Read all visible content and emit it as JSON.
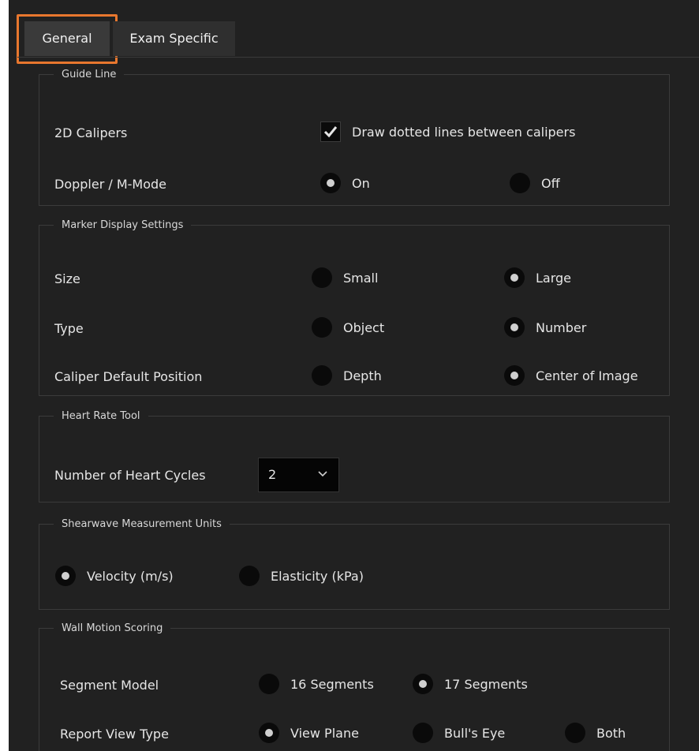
{
  "tabs": [
    {
      "label": "General",
      "active": true
    },
    {
      "label": "Exam Specific",
      "active": false
    }
  ],
  "colors": {
    "panel_bg": "#212121",
    "focus_outline": "#e8772e",
    "radio_fill": "#0a0a0a"
  },
  "guide_line": {
    "legend": "Guide Line",
    "calipers_label": "2D Calipers",
    "dotted_lines": {
      "label": "Draw dotted lines between calipers",
      "checked": true
    },
    "doppler_label": "Doppler / M-Mode",
    "doppler_options": [
      {
        "label": "On",
        "selected": true
      },
      {
        "label": "Off",
        "selected": false
      }
    ]
  },
  "marker_display": {
    "legend": "Marker Display Settings",
    "size_label": "Size",
    "size_options": [
      {
        "label": "Small",
        "selected": false
      },
      {
        "label": "Large",
        "selected": true
      }
    ],
    "type_label": "Type",
    "type_options": [
      {
        "label": "Object",
        "selected": false
      },
      {
        "label": "Number",
        "selected": true
      }
    ],
    "caliper_label": "Caliper Default Position",
    "caliper_options": [
      {
        "label": "Depth",
        "selected": false
      },
      {
        "label": "Center of Image",
        "selected": true
      }
    ]
  },
  "heart_rate": {
    "legend": "Heart Rate Tool",
    "cycles_label": "Number of Heart Cycles",
    "cycles_value": "2"
  },
  "shearwave": {
    "legend": "Shearwave Measurement Units",
    "options": [
      {
        "label": "Velocity (m/s)",
        "selected": true
      },
      {
        "label": "Elasticity (kPa)",
        "selected": false
      }
    ]
  },
  "wall_motion": {
    "legend": "Wall Motion Scoring",
    "segment_label": "Segment Model",
    "segment_options": [
      {
        "label": "16 Segments",
        "selected": false
      },
      {
        "label": "17 Segments",
        "selected": true
      }
    ],
    "report_label": "Report View Type",
    "report_options": [
      {
        "label": "View Plane",
        "selected": true
      },
      {
        "label": "Bull's Eye",
        "selected": false
      },
      {
        "label": "Both",
        "selected": false
      }
    ]
  }
}
